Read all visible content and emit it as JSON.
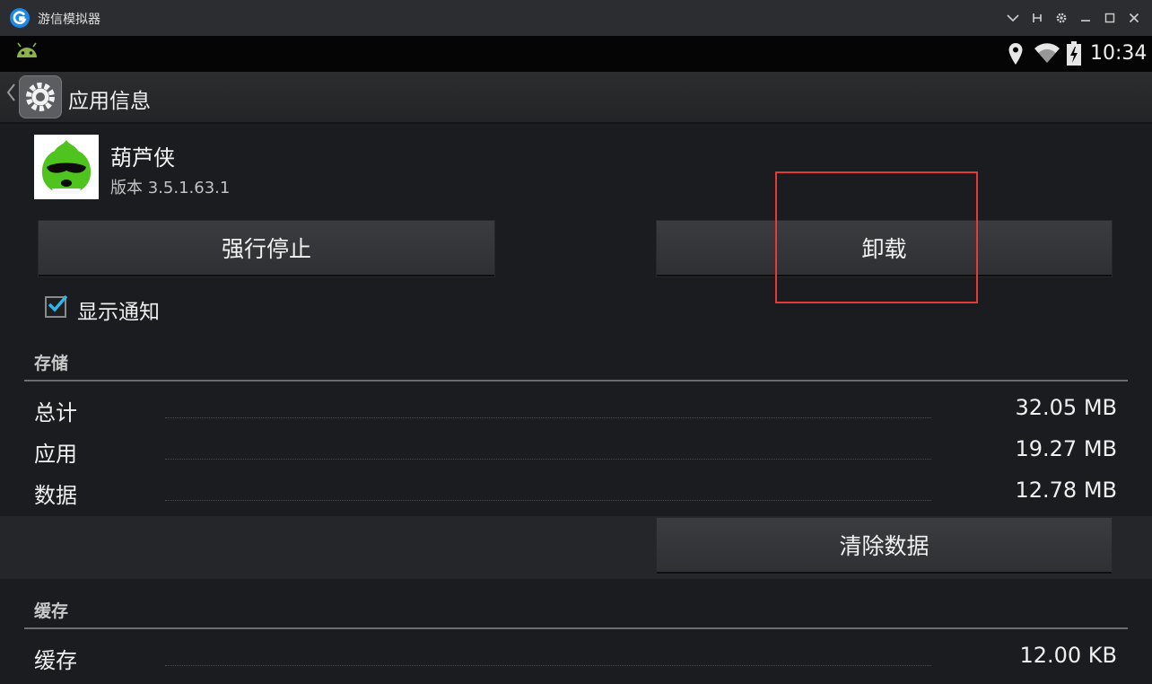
{
  "window": {
    "title": "游信模拟器",
    "controls": [
      "chevron-down",
      "pin",
      "settings",
      "minimize",
      "maximize",
      "close"
    ]
  },
  "statusbar": {
    "time": "10:34"
  },
  "actionbar": {
    "title": "应用信息"
  },
  "app": {
    "name": "葫芦侠",
    "version": "版本 3.5.1.63.1"
  },
  "buttons": {
    "force_stop": "强行停止",
    "uninstall": "卸载",
    "clear_data": "清除数据"
  },
  "notification": {
    "label": "显示通知",
    "checked": true
  },
  "storage": {
    "header": "存储",
    "rows": [
      {
        "label": "总计",
        "value": "32.05 MB"
      },
      {
        "label": "应用",
        "value": "19.27 MB"
      },
      {
        "label": "数据",
        "value": "12.78 MB"
      }
    ]
  },
  "cache": {
    "header": "缓存",
    "rows": [
      {
        "label": "缓存",
        "value": "12.00 KB"
      }
    ]
  },
  "colors": {
    "accent_check": "#33b5e5",
    "highlight_box": "#e53a3a",
    "app_icon_green": "#4fc31e"
  }
}
